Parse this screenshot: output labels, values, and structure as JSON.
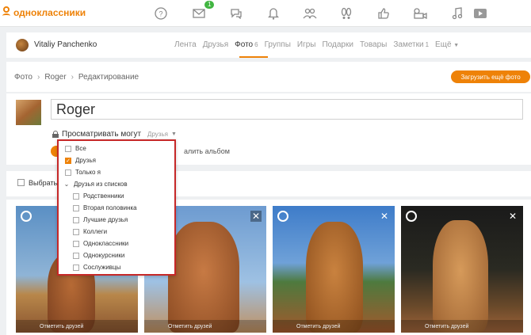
{
  "header": {
    "logo_text": "одноклассники",
    "notification_count": "1",
    "icons": [
      "help-icon",
      "mail-icon",
      "chat-icon",
      "bell-icon",
      "friends-icon",
      "guests-icon",
      "like-icon",
      "camera-icon",
      "music-icon",
      "video-icon"
    ]
  },
  "user": {
    "name": "Vitaliy Panchenko"
  },
  "nav": {
    "feed": "Лента",
    "friends": "Друзья",
    "photos": "Фото",
    "photos_count": "6",
    "groups": "Группы",
    "games": "Игры",
    "gifts": "Подарки",
    "goods": "Товары",
    "notes": "Заметки",
    "notes_count": "1",
    "more": "Ещё"
  },
  "breadcrumb": {
    "root": "Фото",
    "album": "Roger",
    "current": "Редактирование"
  },
  "upload_button": "Загрузить ещё фото",
  "album": {
    "title": "Roger",
    "privacy_label": "Просматривать могут",
    "privacy_value": "Друзья",
    "delete_link": "алить альбом"
  },
  "select_label": "Выбрать",
  "privacy_dropdown": {
    "options": [
      {
        "label": "Все",
        "checked": false
      },
      {
        "label": "Друзья",
        "checked": true
      },
      {
        "label": "Только я",
        "checked": false
      }
    ],
    "group_label": "Друзья из списков",
    "group_options": [
      {
        "label": "Родственники",
        "checked": false
      },
      {
        "label": "Вторая половинка",
        "checked": false
      },
      {
        "label": "Лучшие друзья",
        "checked": false
      },
      {
        "label": "Коллеги",
        "checked": false
      },
      {
        "label": "Одноклассники",
        "checked": false
      },
      {
        "label": "Однокурсники",
        "checked": false
      },
      {
        "label": "Сослуживцы",
        "checked": false
      }
    ]
  },
  "photos": [
    {
      "tag_label": "Отметить друзей"
    },
    {
      "tag_label": "Отметить друзей"
    },
    {
      "tag_label": "Отметить друзей"
    },
    {
      "tag_label": "Отметить друзей"
    }
  ]
}
